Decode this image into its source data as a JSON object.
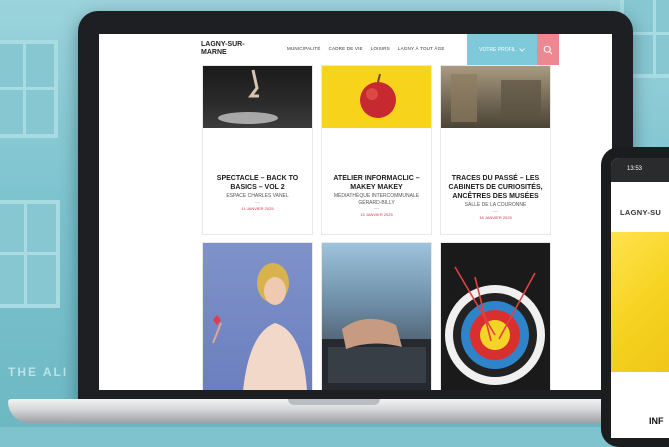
{
  "site": {
    "logo": "LAGNY-SUR-MARNE",
    "nav": [
      "MUNICIPALITÉ",
      "CADRE DE VIE",
      "LOISIRS",
      "LAGNY À TOUT ÂGE"
    ],
    "profile_label": "VOTRE PROFIL"
  },
  "events": [
    {
      "title": "SPECTACLE – BACK TO BASICS – VOL 2",
      "venue": "ESPACE CHARLES VANEL",
      "dash": "—",
      "date": "11 JANVIER 2025"
    },
    {
      "title": "ATELIER INFORMACLIC – MAKEY MAKEY",
      "venue": "MÉDIATHÈQUE INTERCOMMUNALE GÉRARD-BILLY",
      "dash": "—",
      "date": "15 JANVIER 2025"
    },
    {
      "title": "TRACES DU PASSÉ – LES CABINETS DE CURIOSITÉS, ANCÊTRES DES MUSÉES",
      "venue": "SALLE DE LA COURONNE",
      "dash": "—",
      "date": "16 JANVIER 2025"
    }
  ],
  "phone": {
    "time": "13:53",
    "logo": "LAGNY-SU",
    "card_title": "INF"
  },
  "background_sign": "THE ALI",
  "colors": {
    "profile_button": "#7ec9da",
    "search_button": "#ee8792",
    "date_red": "#d5314a",
    "background_teal": "#7fc3cf"
  }
}
